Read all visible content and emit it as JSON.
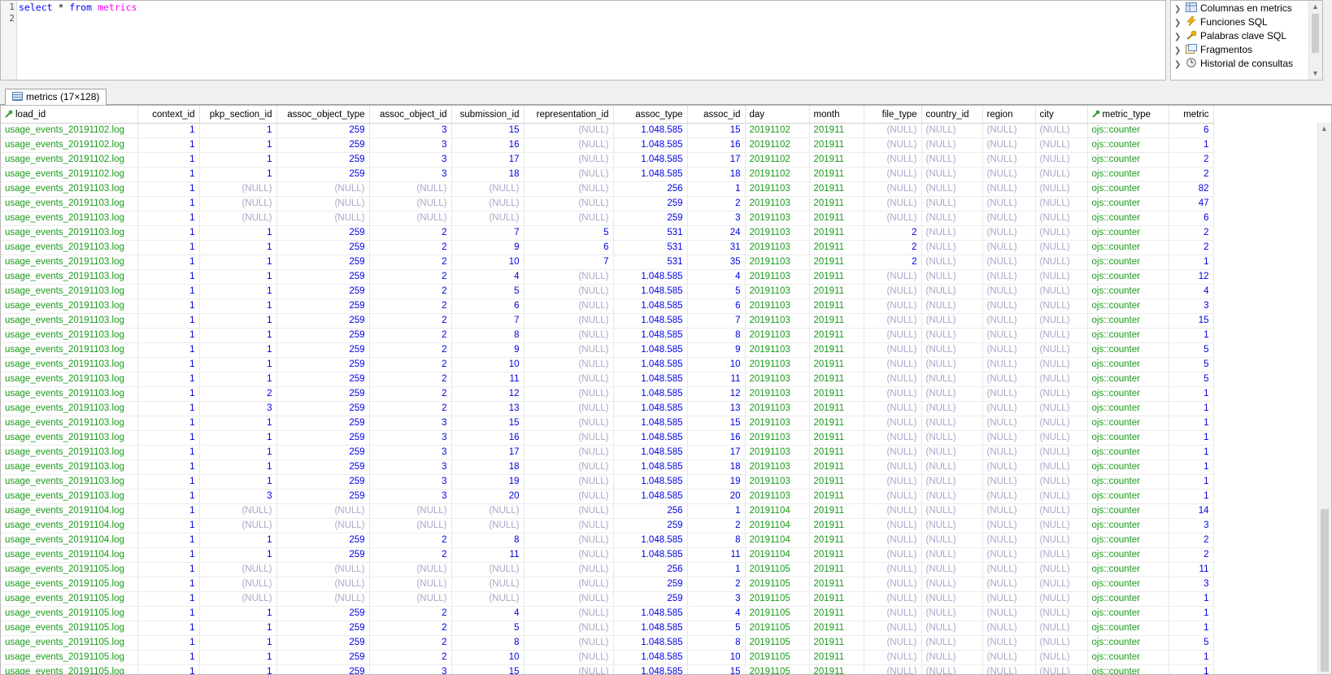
{
  "editor": {
    "line_numbers": [
      "1",
      "2"
    ],
    "query": {
      "kw1": "select",
      "star": " * ",
      "kw2": "from",
      "space": " ",
      "table": "metrics"
    }
  },
  "helper": {
    "items": [
      {
        "label": "Columnas en metrics",
        "icon": "table-columns-icon"
      },
      {
        "label": "Funciones SQL",
        "icon": "lightning-icon"
      },
      {
        "label": "Palabras clave SQL",
        "icon": "key-icon"
      },
      {
        "label": "Fragmentos",
        "icon": "snippet-icon"
      },
      {
        "label": "Historial de consultas",
        "icon": "history-clock-icon"
      }
    ]
  },
  "result_tab": {
    "label": "metrics (17×128)"
  },
  "colors": {
    "text": "#1a9b1a",
    "number": "#0000e0",
    "null": "#a8a8c8"
  },
  "grid": {
    "columns": [
      {
        "name": "load_id",
        "key": true,
        "w": 168,
        "align": "l"
      },
      {
        "name": "context_id",
        "w": 76
      },
      {
        "name": "pkp_section_id",
        "w": 95
      },
      {
        "name": "assoc_object_type",
        "w": 114
      },
      {
        "name": "assoc_object_id",
        "w": 101
      },
      {
        "name": "submission_id",
        "w": 89
      },
      {
        "name": "representation_id",
        "w": 110
      },
      {
        "name": "assoc_type",
        "w": 91
      },
      {
        "name": "assoc_id",
        "w": 71
      },
      {
        "name": "day",
        "w": 79,
        "align": "l"
      },
      {
        "name": "month",
        "w": 67,
        "align": "l"
      },
      {
        "name": "file_type",
        "w": 71
      },
      {
        "name": "country_id",
        "w": 75,
        "align": "l"
      },
      {
        "name": "region",
        "w": 65,
        "align": "l"
      },
      {
        "name": "city",
        "w": 64,
        "align": "l"
      },
      {
        "name": "metric_type",
        "key": true,
        "w": 100,
        "align": "l"
      },
      {
        "name": "metric",
        "w": 55
      }
    ],
    "rows": [
      [
        "usage_events_20191102.log",
        "1",
        "1",
        "259",
        "3",
        "15",
        "(NULL)",
        "1.048.585",
        "15",
        "20191102",
        "201911",
        "(NULL)",
        "(NULL)",
        "(NULL)",
        "(NULL)",
        "ojs::counter",
        "6"
      ],
      [
        "usage_events_20191102.log",
        "1",
        "1",
        "259",
        "3",
        "16",
        "(NULL)",
        "1.048.585",
        "16",
        "20191102",
        "201911",
        "(NULL)",
        "(NULL)",
        "(NULL)",
        "(NULL)",
        "ojs::counter",
        "1"
      ],
      [
        "usage_events_20191102.log",
        "1",
        "1",
        "259",
        "3",
        "17",
        "(NULL)",
        "1.048.585",
        "17",
        "20191102",
        "201911",
        "(NULL)",
        "(NULL)",
        "(NULL)",
        "(NULL)",
        "ojs::counter",
        "2"
      ],
      [
        "usage_events_20191102.log",
        "1",
        "1",
        "259",
        "3",
        "18",
        "(NULL)",
        "1.048.585",
        "18",
        "20191102",
        "201911",
        "(NULL)",
        "(NULL)",
        "(NULL)",
        "(NULL)",
        "ojs::counter",
        "2"
      ],
      [
        "usage_events_20191103.log",
        "1",
        "(NULL)",
        "(NULL)",
        "(NULL)",
        "(NULL)",
        "(NULL)",
        "256",
        "1",
        "20191103",
        "201911",
        "(NULL)",
        "(NULL)",
        "(NULL)",
        "(NULL)",
        "ojs::counter",
        "82"
      ],
      [
        "usage_events_20191103.log",
        "1",
        "(NULL)",
        "(NULL)",
        "(NULL)",
        "(NULL)",
        "(NULL)",
        "259",
        "2",
        "20191103",
        "201911",
        "(NULL)",
        "(NULL)",
        "(NULL)",
        "(NULL)",
        "ojs::counter",
        "47"
      ],
      [
        "usage_events_20191103.log",
        "1",
        "(NULL)",
        "(NULL)",
        "(NULL)",
        "(NULL)",
        "(NULL)",
        "259",
        "3",
        "20191103",
        "201911",
        "(NULL)",
        "(NULL)",
        "(NULL)",
        "(NULL)",
        "ojs::counter",
        "6"
      ],
      [
        "usage_events_20191103.log",
        "1",
        "1",
        "259",
        "2",
        "7",
        "5",
        "531",
        "24",
        "20191103",
        "201911",
        "2",
        "(NULL)",
        "(NULL)",
        "(NULL)",
        "ojs::counter",
        "2"
      ],
      [
        "usage_events_20191103.log",
        "1",
        "1",
        "259",
        "2",
        "9",
        "6",
        "531",
        "31",
        "20191103",
        "201911",
        "2",
        "(NULL)",
        "(NULL)",
        "(NULL)",
        "ojs::counter",
        "2"
      ],
      [
        "usage_events_20191103.log",
        "1",
        "1",
        "259",
        "2",
        "10",
        "7",
        "531",
        "35",
        "20191103",
        "201911",
        "2",
        "(NULL)",
        "(NULL)",
        "(NULL)",
        "ojs::counter",
        "1"
      ],
      [
        "usage_events_20191103.log",
        "1",
        "1",
        "259",
        "2",
        "4",
        "(NULL)",
        "1.048.585",
        "4",
        "20191103",
        "201911",
        "(NULL)",
        "(NULL)",
        "(NULL)",
        "(NULL)",
        "ojs::counter",
        "12"
      ],
      [
        "usage_events_20191103.log",
        "1",
        "1",
        "259",
        "2",
        "5",
        "(NULL)",
        "1.048.585",
        "5",
        "20191103",
        "201911",
        "(NULL)",
        "(NULL)",
        "(NULL)",
        "(NULL)",
        "ojs::counter",
        "4"
      ],
      [
        "usage_events_20191103.log",
        "1",
        "1",
        "259",
        "2",
        "6",
        "(NULL)",
        "1.048.585",
        "6",
        "20191103",
        "201911",
        "(NULL)",
        "(NULL)",
        "(NULL)",
        "(NULL)",
        "ojs::counter",
        "3"
      ],
      [
        "usage_events_20191103.log",
        "1",
        "1",
        "259",
        "2",
        "7",
        "(NULL)",
        "1.048.585",
        "7",
        "20191103",
        "201911",
        "(NULL)",
        "(NULL)",
        "(NULL)",
        "(NULL)",
        "ojs::counter",
        "15"
      ],
      [
        "usage_events_20191103.log",
        "1",
        "1",
        "259",
        "2",
        "8",
        "(NULL)",
        "1.048.585",
        "8",
        "20191103",
        "201911",
        "(NULL)",
        "(NULL)",
        "(NULL)",
        "(NULL)",
        "ojs::counter",
        "1"
      ],
      [
        "usage_events_20191103.log",
        "1",
        "1",
        "259",
        "2",
        "9",
        "(NULL)",
        "1.048.585",
        "9",
        "20191103",
        "201911",
        "(NULL)",
        "(NULL)",
        "(NULL)",
        "(NULL)",
        "ojs::counter",
        "5"
      ],
      [
        "usage_events_20191103.log",
        "1",
        "1",
        "259",
        "2",
        "10",
        "(NULL)",
        "1.048.585",
        "10",
        "20191103",
        "201911",
        "(NULL)",
        "(NULL)",
        "(NULL)",
        "(NULL)",
        "ojs::counter",
        "5"
      ],
      [
        "usage_events_20191103.log",
        "1",
        "1",
        "259",
        "2",
        "11",
        "(NULL)",
        "1.048.585",
        "11",
        "20191103",
        "201911",
        "(NULL)",
        "(NULL)",
        "(NULL)",
        "(NULL)",
        "ojs::counter",
        "5"
      ],
      [
        "usage_events_20191103.log",
        "1",
        "2",
        "259",
        "2",
        "12",
        "(NULL)",
        "1.048.585",
        "12",
        "20191103",
        "201911",
        "(NULL)",
        "(NULL)",
        "(NULL)",
        "(NULL)",
        "ojs::counter",
        "1"
      ],
      [
        "usage_events_20191103.log",
        "1",
        "3",
        "259",
        "2",
        "13",
        "(NULL)",
        "1.048.585",
        "13",
        "20191103",
        "201911",
        "(NULL)",
        "(NULL)",
        "(NULL)",
        "(NULL)",
        "ojs::counter",
        "1"
      ],
      [
        "usage_events_20191103.log",
        "1",
        "1",
        "259",
        "3",
        "15",
        "(NULL)",
        "1.048.585",
        "15",
        "20191103",
        "201911",
        "(NULL)",
        "(NULL)",
        "(NULL)",
        "(NULL)",
        "ojs::counter",
        "1"
      ],
      [
        "usage_events_20191103.log",
        "1",
        "1",
        "259",
        "3",
        "16",
        "(NULL)",
        "1.048.585",
        "16",
        "20191103",
        "201911",
        "(NULL)",
        "(NULL)",
        "(NULL)",
        "(NULL)",
        "ojs::counter",
        "1"
      ],
      [
        "usage_events_20191103.log",
        "1",
        "1",
        "259",
        "3",
        "17",
        "(NULL)",
        "1.048.585",
        "17",
        "20191103",
        "201911",
        "(NULL)",
        "(NULL)",
        "(NULL)",
        "(NULL)",
        "ojs::counter",
        "1"
      ],
      [
        "usage_events_20191103.log",
        "1",
        "1",
        "259",
        "3",
        "18",
        "(NULL)",
        "1.048.585",
        "18",
        "20191103",
        "201911",
        "(NULL)",
        "(NULL)",
        "(NULL)",
        "(NULL)",
        "ojs::counter",
        "1"
      ],
      [
        "usage_events_20191103.log",
        "1",
        "1",
        "259",
        "3",
        "19",
        "(NULL)",
        "1.048.585",
        "19",
        "20191103",
        "201911",
        "(NULL)",
        "(NULL)",
        "(NULL)",
        "(NULL)",
        "ojs::counter",
        "1"
      ],
      [
        "usage_events_20191103.log",
        "1",
        "3",
        "259",
        "3",
        "20",
        "(NULL)",
        "1.048.585",
        "20",
        "20191103",
        "201911",
        "(NULL)",
        "(NULL)",
        "(NULL)",
        "(NULL)",
        "ojs::counter",
        "1"
      ],
      [
        "usage_events_20191104.log",
        "1",
        "(NULL)",
        "(NULL)",
        "(NULL)",
        "(NULL)",
        "(NULL)",
        "256",
        "1",
        "20191104",
        "201911",
        "(NULL)",
        "(NULL)",
        "(NULL)",
        "(NULL)",
        "ojs::counter",
        "14"
      ],
      [
        "usage_events_20191104.log",
        "1",
        "(NULL)",
        "(NULL)",
        "(NULL)",
        "(NULL)",
        "(NULL)",
        "259",
        "2",
        "20191104",
        "201911",
        "(NULL)",
        "(NULL)",
        "(NULL)",
        "(NULL)",
        "ojs::counter",
        "3"
      ],
      [
        "usage_events_20191104.log",
        "1",
        "1",
        "259",
        "2",
        "8",
        "(NULL)",
        "1.048.585",
        "8",
        "20191104",
        "201911",
        "(NULL)",
        "(NULL)",
        "(NULL)",
        "(NULL)",
        "ojs::counter",
        "2"
      ],
      [
        "usage_events_20191104.log",
        "1",
        "1",
        "259",
        "2",
        "11",
        "(NULL)",
        "1.048.585",
        "11",
        "20191104",
        "201911",
        "(NULL)",
        "(NULL)",
        "(NULL)",
        "(NULL)",
        "ojs::counter",
        "2"
      ],
      [
        "usage_events_20191105.log",
        "1",
        "(NULL)",
        "(NULL)",
        "(NULL)",
        "(NULL)",
        "(NULL)",
        "256",
        "1",
        "20191105",
        "201911",
        "(NULL)",
        "(NULL)",
        "(NULL)",
        "(NULL)",
        "ojs::counter",
        "11"
      ],
      [
        "usage_events_20191105.log",
        "1",
        "(NULL)",
        "(NULL)",
        "(NULL)",
        "(NULL)",
        "(NULL)",
        "259",
        "2",
        "20191105",
        "201911",
        "(NULL)",
        "(NULL)",
        "(NULL)",
        "(NULL)",
        "ojs::counter",
        "3"
      ],
      [
        "usage_events_20191105.log",
        "1",
        "(NULL)",
        "(NULL)",
        "(NULL)",
        "(NULL)",
        "(NULL)",
        "259",
        "3",
        "20191105",
        "201911",
        "(NULL)",
        "(NULL)",
        "(NULL)",
        "(NULL)",
        "ojs::counter",
        "1"
      ],
      [
        "usage_events_20191105.log",
        "1",
        "1",
        "259",
        "2",
        "4",
        "(NULL)",
        "1.048.585",
        "4",
        "20191105",
        "201911",
        "(NULL)",
        "(NULL)",
        "(NULL)",
        "(NULL)",
        "ojs::counter",
        "1"
      ],
      [
        "usage_events_20191105.log",
        "1",
        "1",
        "259",
        "2",
        "5",
        "(NULL)",
        "1.048.585",
        "5",
        "20191105",
        "201911",
        "(NULL)",
        "(NULL)",
        "(NULL)",
        "(NULL)",
        "ojs::counter",
        "1"
      ],
      [
        "usage_events_20191105.log",
        "1",
        "1",
        "259",
        "2",
        "8",
        "(NULL)",
        "1.048.585",
        "8",
        "20191105",
        "201911",
        "(NULL)",
        "(NULL)",
        "(NULL)",
        "(NULL)",
        "ojs::counter",
        "5"
      ],
      [
        "usage_events_20191105.log",
        "1",
        "1",
        "259",
        "2",
        "10",
        "(NULL)",
        "1.048.585",
        "10",
        "20191105",
        "201911",
        "(NULL)",
        "(NULL)",
        "(NULL)",
        "(NULL)",
        "ojs::counter",
        "1"
      ],
      [
        "usage_events_20191105.log",
        "1",
        "1",
        "259",
        "3",
        "15",
        "(NULL)",
        "1.048.585",
        "15",
        "20191105",
        "201911",
        "(NULL)",
        "(NULL)",
        "(NULL)",
        "(NULL)",
        "ojs::counter",
        "1"
      ]
    ]
  }
}
